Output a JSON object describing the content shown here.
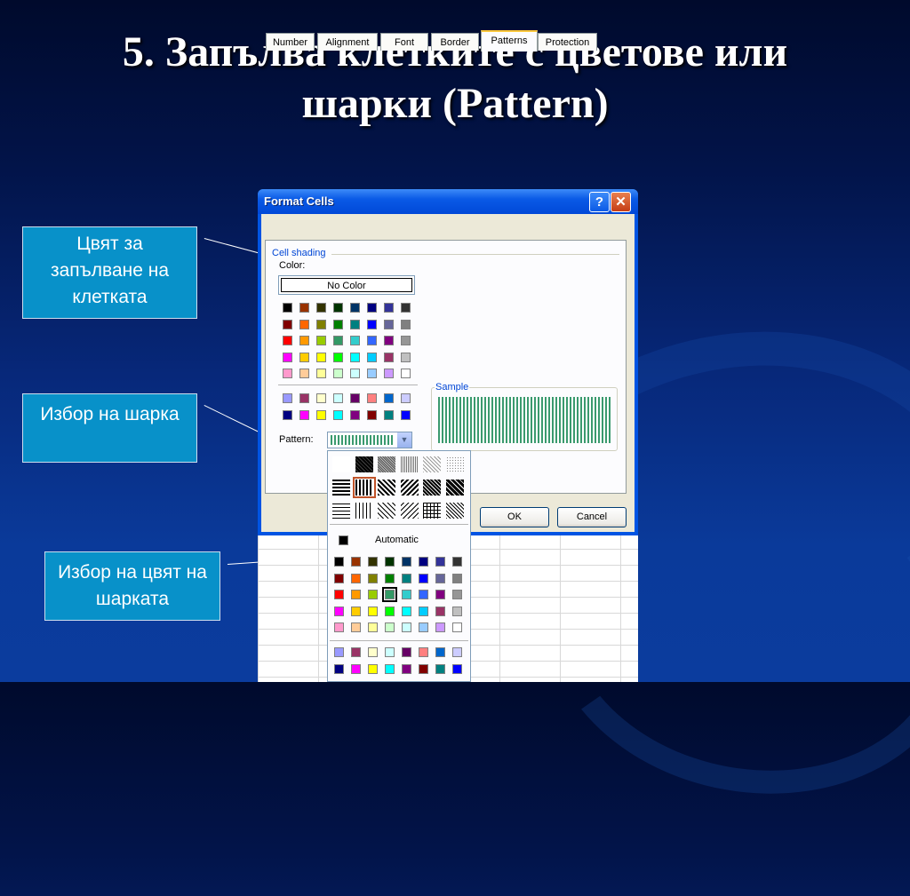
{
  "slide": {
    "title_line1": "5. Запълва клетките с цветове или",
    "title_line2": "шарки (Pattern)"
  },
  "callouts": {
    "fill_color": "Цвят за запълване на клетката",
    "pattern_choice": "Избор на шарка",
    "pattern_color": "Избор на цвят на шарката"
  },
  "dialog": {
    "title": "Format Cells",
    "help_label": "?",
    "close_label": "✕",
    "tabs": [
      "Number",
      "Alignment",
      "Font",
      "Border",
      "Patterns",
      "Protection"
    ],
    "active_tab": "Patterns",
    "cell_shading_label": "Cell shading",
    "color_label": "Color:",
    "no_color_label": "No Color",
    "sample_label": "Sample",
    "pattern_label": "Pattern:",
    "ok_label": "OK",
    "cancel_label": "Cancel"
  },
  "dropdown": {
    "automatic_label": "Automatic",
    "selected_pattern": "vertical-stripe",
    "selected_color": "#339966"
  },
  "colors": {
    "accent": "#0891c9",
    "pattern_color": "#3a9a6e",
    "palette_main": [
      [
        "#000000",
        "#993300",
        "#333300",
        "#003300",
        "#003366",
        "#000080",
        "#333399",
        "#333333"
      ],
      [
        "#800000",
        "#FF6600",
        "#808000",
        "#008000",
        "#008080",
        "#0000FF",
        "#666699",
        "#808080"
      ],
      [
        "#FF0000",
        "#FF9900",
        "#99CC00",
        "#339966",
        "#33CCCC",
        "#3366FF",
        "#800080",
        "#969696"
      ],
      [
        "#FF00FF",
        "#FFCC00",
        "#FFFF00",
        "#00FF00",
        "#00FFFF",
        "#00CCFF",
        "#993366",
        "#C0C0C0"
      ],
      [
        "#FF99CC",
        "#FFCC99",
        "#FFFF99",
        "#CCFFCC",
        "#CCFFFF",
        "#99CCFF",
        "#CC99FF",
        "#FFFFFF"
      ]
    ],
    "palette_extra": [
      [
        "#9999FF",
        "#993366",
        "#FFFFCC",
        "#CCFFFF",
        "#660066",
        "#FF8080",
        "#0066CC",
        "#CCCCFF"
      ],
      [
        "#000080",
        "#FF00FF",
        "#FFFF00",
        "#00FFFF",
        "#800080",
        "#800000",
        "#008080",
        "#0000FF"
      ]
    ]
  }
}
